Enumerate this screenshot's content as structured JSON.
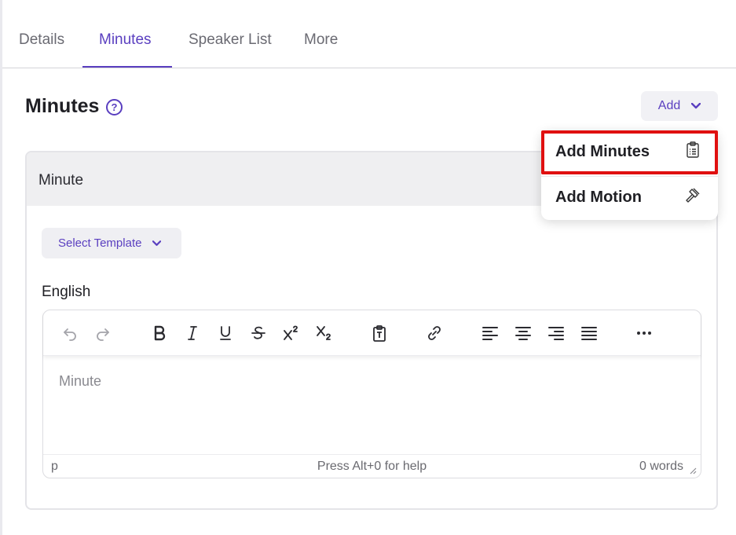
{
  "tabs": [
    {
      "label": "Details"
    },
    {
      "label": "Minutes"
    },
    {
      "label": "Speaker List"
    },
    {
      "label": "More"
    }
  ],
  "active_tab": "Minutes",
  "section": {
    "title": "Minutes",
    "help_icon": "question-circle-icon"
  },
  "add_button": {
    "label": "Add",
    "icon": "chevron-down-icon"
  },
  "dropdown": {
    "items": [
      {
        "label": "Add Minutes",
        "icon": "clipboard-list-icon",
        "highlighted": true
      },
      {
        "label": "Add Motion",
        "icon": "gavel-icon",
        "highlighted": false
      }
    ]
  },
  "card": {
    "title": "Minute",
    "template_button": "Select Template",
    "language_label": "English"
  },
  "editor": {
    "toolbar": [
      "undo",
      "redo",
      "bold",
      "italic",
      "underline",
      "strikethrough",
      "superscript",
      "subscript",
      "paste-as-text",
      "link",
      "align-left",
      "align-center",
      "align-right",
      "justify",
      "more"
    ],
    "placeholder": "Minute",
    "status_path": "p",
    "status_help": "Press Alt+0 for help",
    "word_count": "0 words"
  },
  "colors": {
    "accent": "#5a3fc0",
    "highlight_border": "#e01010"
  }
}
